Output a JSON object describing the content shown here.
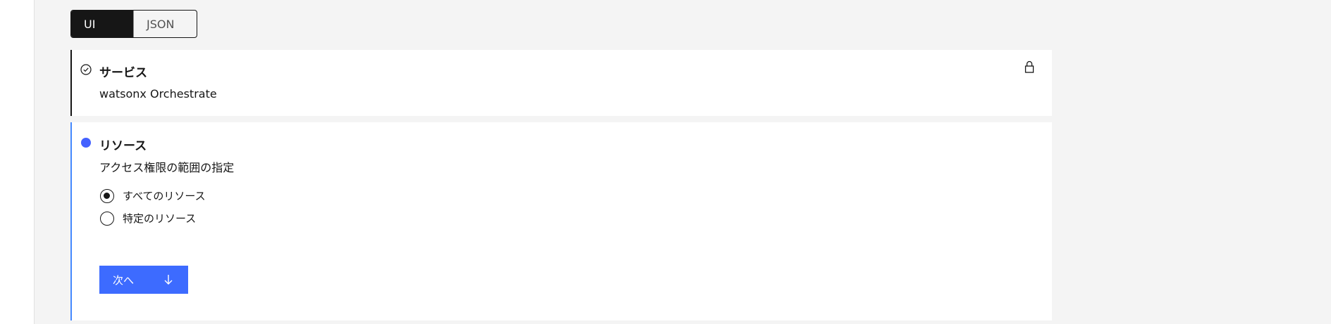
{
  "view_switcher": {
    "ui_label": "UI",
    "json_label": "JSON",
    "selected": "UI"
  },
  "service_step": {
    "title": "サービス",
    "value": "watsonx Orchestrate",
    "status": "complete",
    "locked": true
  },
  "resource_step": {
    "title": "リソース",
    "description": "アクセス権限の範囲の指定",
    "status": "current",
    "options": [
      {
        "label": "すべてのリソース",
        "checked": true
      },
      {
        "label": "特定のリソース",
        "checked": false
      }
    ],
    "next_button_label": "次へ"
  },
  "colors": {
    "accent": "#3d6bff",
    "current_dot": "#4361ff",
    "text": "#161616",
    "background": "#f4f4f4"
  }
}
